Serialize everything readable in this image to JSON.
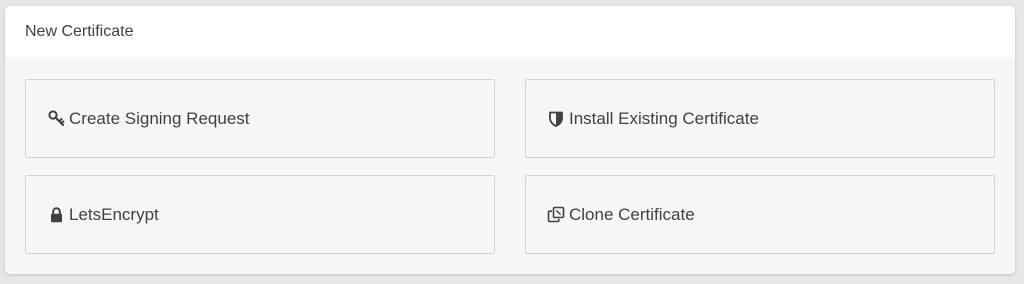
{
  "panel": {
    "title": "New Certificate"
  },
  "options": [
    {
      "label": "Create Signing Request",
      "icon": "key-icon"
    },
    {
      "label": "Install Existing Certificate",
      "icon": "shield-icon"
    },
    {
      "label": "LetsEncrypt",
      "icon": "lock-icon"
    },
    {
      "label": "Clone Certificate",
      "icon": "clone-icon"
    }
  ],
  "colors": {
    "background": "#e6e6e6",
    "panel": "#f6f6f6",
    "header": "#ffffff",
    "border": "#d3d3d3",
    "text": "#3d4246"
  }
}
